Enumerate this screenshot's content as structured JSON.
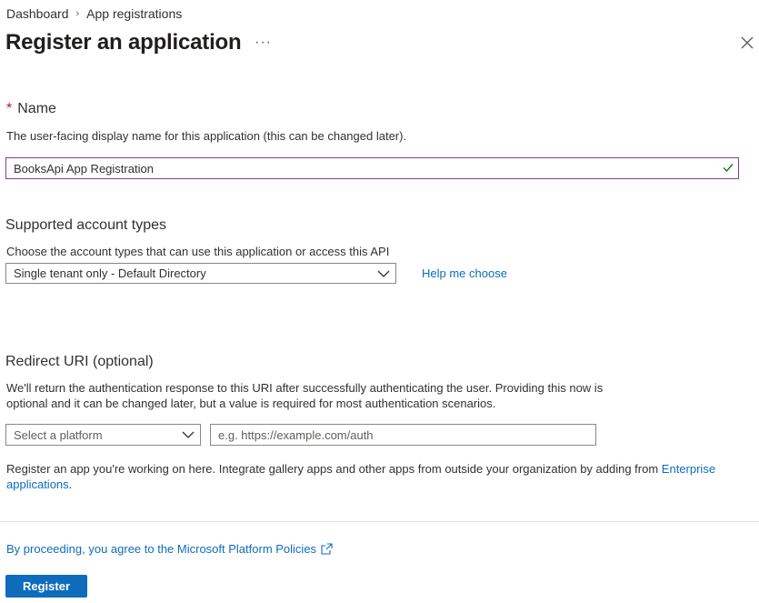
{
  "breadcrumb": {
    "items": [
      "Dashboard",
      "App registrations"
    ]
  },
  "page": {
    "title": "Register an application",
    "more": "···"
  },
  "name_section": {
    "label": "Name",
    "required_marker": "*",
    "description": "The user-facing display name for this application (this can be changed later).",
    "value": "BooksApi App Registration"
  },
  "account_types": {
    "heading": "Supported account types",
    "description": "Choose the account types that can use this application or access this API",
    "selected": "Single tenant only - Default Directory",
    "help_link": "Help me choose"
  },
  "redirect": {
    "heading": "Redirect URI (optional)",
    "description_line1": "We'll return the authentication response to this URI after successfully authenticating the user. Providing this now is",
    "description_line2": "optional and it can be changed later, but a value is required for most authentication scenarios.",
    "platform_placeholder": "Select a platform",
    "uri_placeholder": "e.g. https://example.com/auth"
  },
  "gallery_note": {
    "text": "Register an app you're working on here. Integrate gallery apps and other apps from outside your organization by adding from ",
    "link_line1": "Enterprise",
    "link_line2": "applications",
    "suffix": "."
  },
  "policy": {
    "link": "By proceeding, you agree to the Microsoft Platform Policies"
  },
  "actions": {
    "register": "Register"
  },
  "colors": {
    "accent": "#0f6cbd",
    "input_focus_border": "#8a3a96",
    "valid_check": "#107c10",
    "required": "#c50f1f"
  }
}
